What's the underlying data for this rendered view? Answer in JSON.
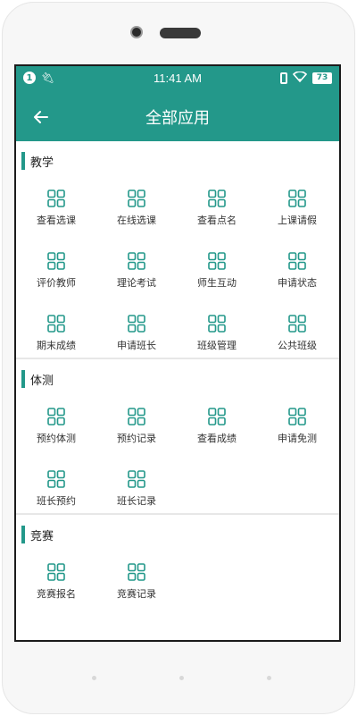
{
  "colors": {
    "accent": "#23988a",
    "text": "#222222",
    "divider": "#e7e7e7"
  },
  "status_bar": {
    "notification_badge": "1",
    "time": "11:41 AM",
    "battery": "73"
  },
  "app_bar": {
    "back_icon": "arrow-left-icon",
    "title": "全部应用"
  },
  "sections": [
    {
      "title": "教学",
      "items": [
        "查看选课",
        "在线选课",
        "查看点名",
        "上课请假",
        "评价教师",
        "理论考试",
        "师生互动",
        "申请状态",
        "期末成绩",
        "申请班长",
        "班级管理",
        "公共班级"
      ]
    },
    {
      "title": "体测",
      "items": [
        "预约体测",
        "预约记录",
        "查看成绩",
        "申请免测",
        "班长预约",
        "班长记录"
      ]
    },
    {
      "title": "竞赛",
      "items": [
        "竞赛报名",
        "竞赛记录"
      ]
    }
  ],
  "item_icon": "grid-four-squares-icon"
}
